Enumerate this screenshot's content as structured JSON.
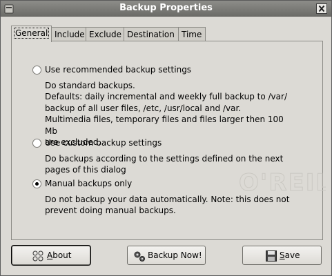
{
  "window": {
    "title": "Backup Properties"
  },
  "tabs": [
    {
      "label": "General",
      "active": true
    },
    {
      "label": "Include",
      "active": false
    },
    {
      "label": "Exclude",
      "active": false
    },
    {
      "label": "Destination",
      "active": false
    },
    {
      "label": "Time",
      "active": false
    }
  ],
  "options": [
    {
      "label": "Use recommended backup settings",
      "checked": false,
      "description": "Do standard backups.\nDefaults: daily incremental and weekly full backup to /var/\nbackup of all user files, /etc, /usr/local and /var.\nMultimedia files, temporary files and files larger then 100 Mb\nare excluded."
    },
    {
      "label": "Use custom backup settings",
      "checked": false,
      "description": "Do backups according to the settings defined on the next\npages of this dialog"
    },
    {
      "label": "Manual backups only",
      "checked": true,
      "description": "Do not backup your data automatically. Note: this does not\nprevent doing manual backups."
    }
  ],
  "buttons": {
    "about": {
      "mnemonic": "A",
      "rest": "bout",
      "icon": "about-icon"
    },
    "backup_now": {
      "label": "Backup Now!",
      "icon": "backup-gears-icon"
    },
    "save": {
      "mnemonic": "S",
      "rest": "ave",
      "icon": "floppy-disk-icon"
    }
  },
  "icons": {
    "close": "close-icon",
    "window": "window-menu-icon"
  },
  "colors": {
    "window_bg": "#dcdad5",
    "titlebar": "#7b7b77",
    "border": "#8b8a85"
  }
}
